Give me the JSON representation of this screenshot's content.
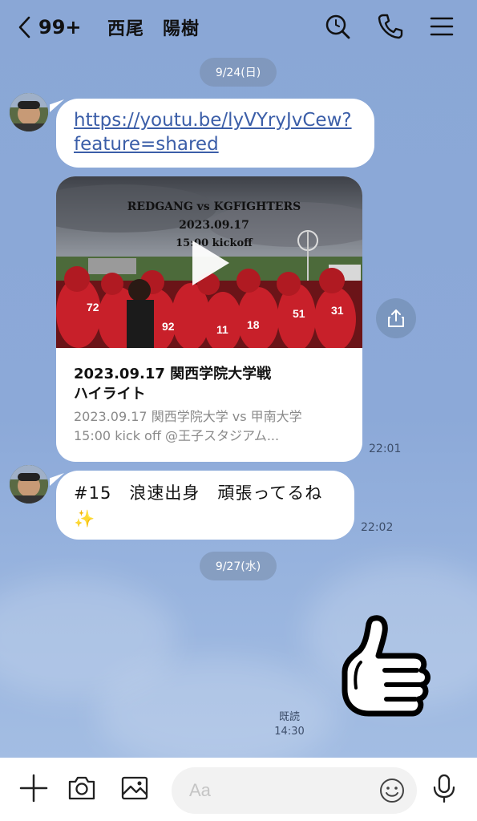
{
  "header": {
    "unread_count": "99+",
    "contact_name": "西尾　陽樹"
  },
  "dates": [
    "9/24(日)",
    "9/27(水)"
  ],
  "messages": {
    "link": {
      "line1": "https://youtu.be/lyVYryJvCew?",
      "line2": "feature=shared"
    },
    "card": {
      "thumb_line1": "REDGANG vs KGFIGHTERS",
      "thumb_line2": "2023.09.17",
      "thumb_line3": "15:00 kickoff",
      "title_line1": "2023.09.17  関西学院大学戦",
      "title_line2": "ハイライト",
      "desc_line1": "2023.09.17 関西学院大学 vs 甲南大学",
      "desc_line2": "15:00 kick off @王子スタジアム...",
      "time": "22:01"
    },
    "text": {
      "line1": "#15　浪速出身　頑張ってるね",
      "line2": "✨",
      "time": "22:02"
    },
    "sticker": {
      "read_label": "既読",
      "time": "14:30"
    }
  },
  "input": {
    "placeholder": "Aa"
  },
  "colors": {
    "background": "#8fabd9",
    "link": "#3b5ea8",
    "jersey_red": "#c8202a"
  },
  "icons": [
    "back-chevron-icon",
    "search-icon",
    "phone-icon",
    "menu-icon",
    "share-icon",
    "play-icon",
    "plus-icon",
    "camera-icon",
    "image-icon",
    "emoji-icon",
    "microphone-icon"
  ]
}
